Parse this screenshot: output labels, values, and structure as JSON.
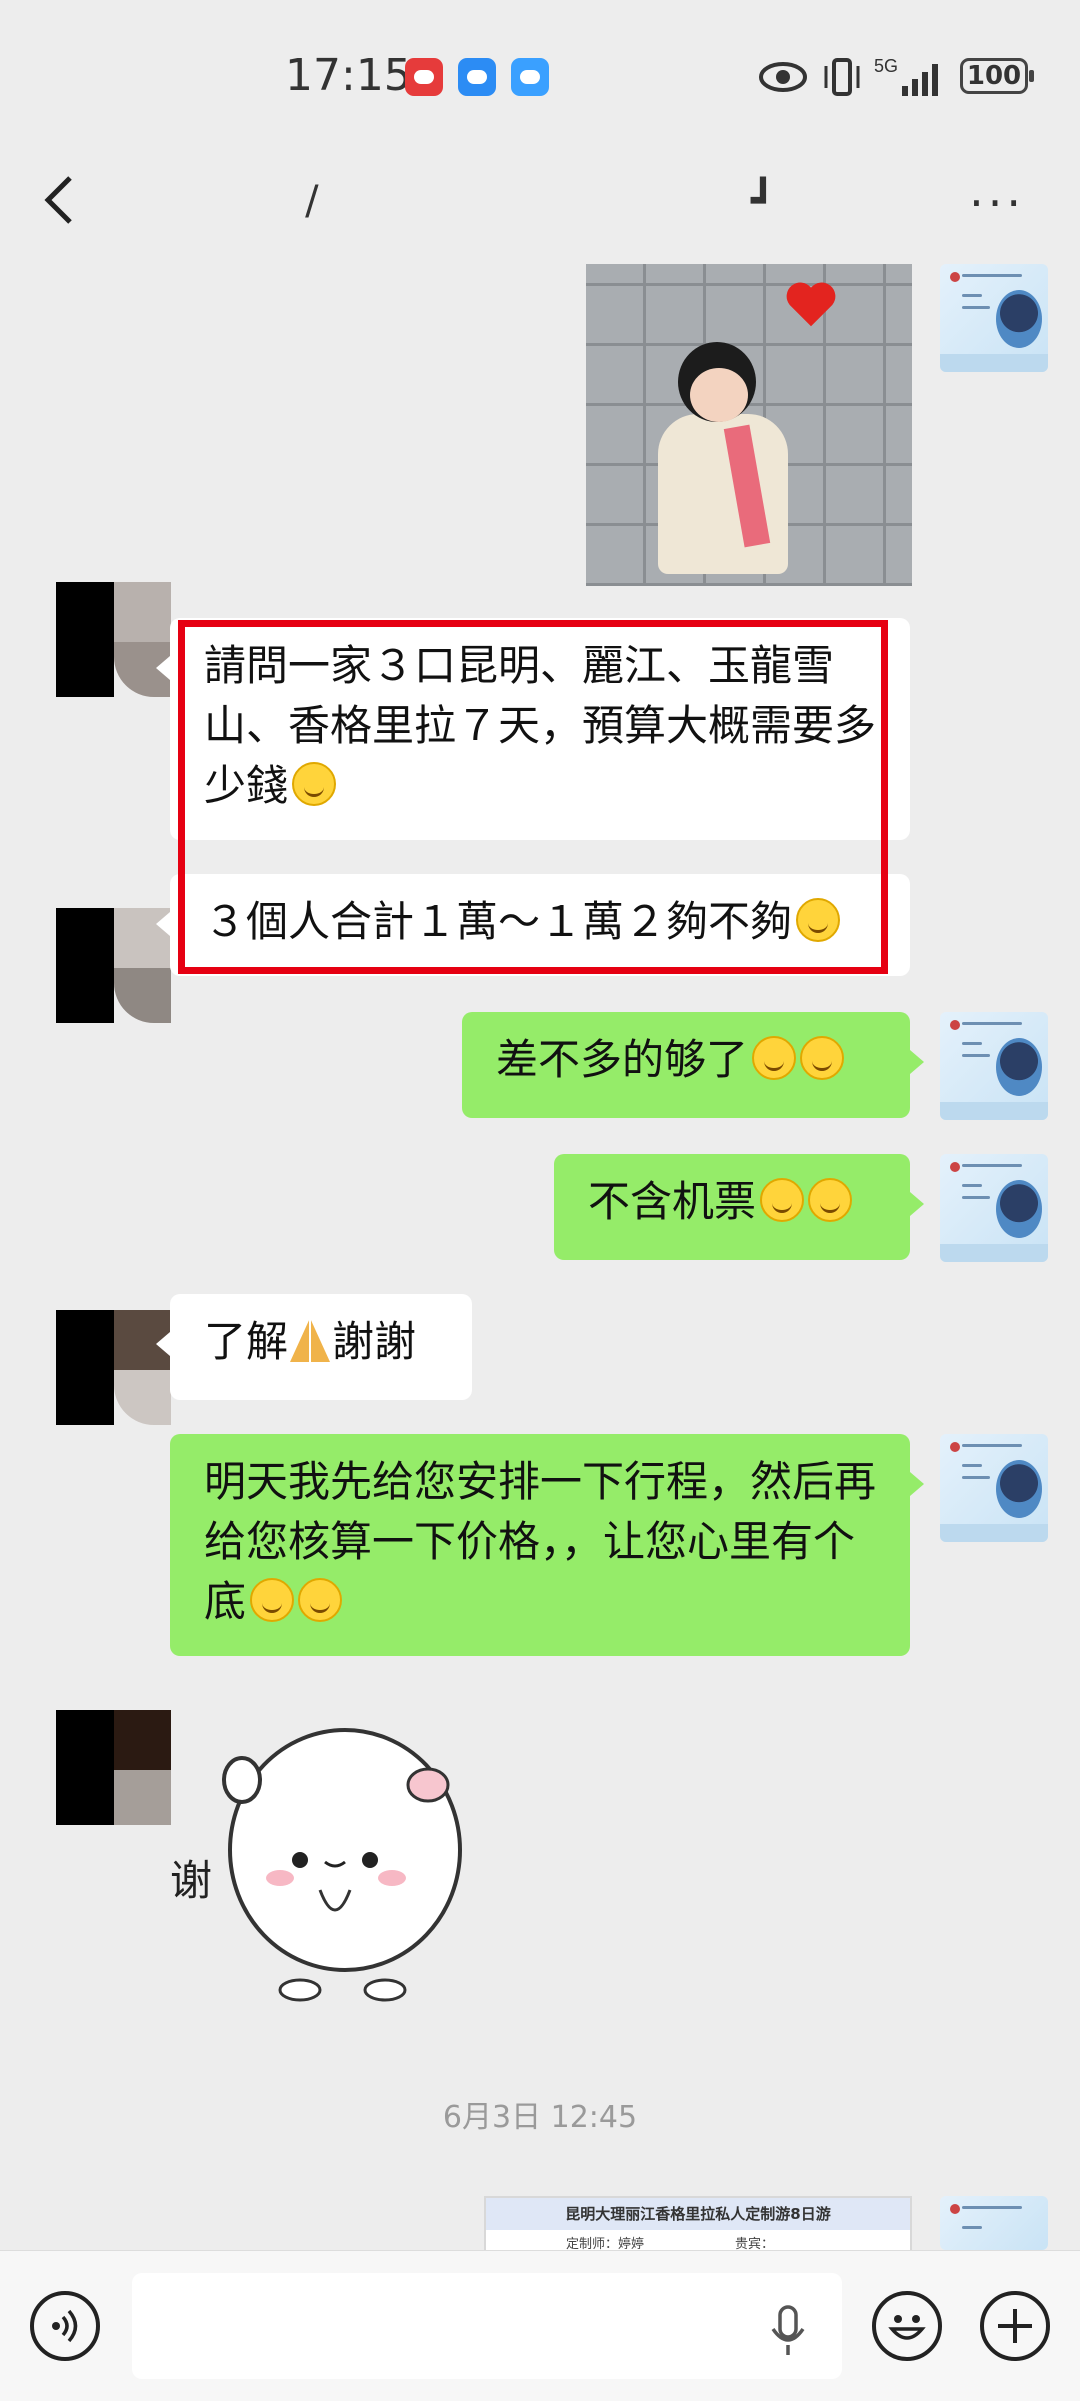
{
  "status_bar": {
    "time": "17:15",
    "network": "5G",
    "battery": "100",
    "icons": [
      "huawei-app-icon",
      "messages-icon",
      "weather-icon",
      "eye-icon",
      "vibrate-icon",
      "signal-icon",
      "battery-icon"
    ]
  },
  "nav": {
    "title": "/                                  ┛",
    "back_icon": "chevron-left-icon",
    "more_label": "···"
  },
  "messages": [
    {
      "from": "other",
      "text": "請問一家３口昆明、麗江、玉龍雪山、香格里拉７天，預算大概需要多少錢",
      "emoji": "smile"
    },
    {
      "from": "other",
      "text": "３個人合計１萬～１萬２夠不夠",
      "emoji": "laugh"
    },
    {
      "from": "me",
      "text": "差不多的够了",
      "emoji": "smile x2"
    },
    {
      "from": "me",
      "text": "不含机票",
      "emoji": "grin x2"
    },
    {
      "from": "other",
      "text_before": "了解",
      "text_after": "謝謝",
      "emoji": "pray"
    },
    {
      "from": "me",
      "text": "明天我先给您安排一下行程，然后再给您核算一下价格，，让您心里有个底",
      "emoji": "smile x2"
    }
  ],
  "sticker": {
    "label": "谢"
  },
  "timestamp": "6月3日 12:45",
  "card": {
    "title": "昆明大理丽江香格里拉私人定制游8日游",
    "line": "定制师：婷婷　　　　　　　贵宾："
  },
  "composer": {
    "placeholder": "",
    "icons": [
      "voice-icon",
      "mic-icon",
      "emoji-icon",
      "plus-icon"
    ]
  },
  "colors": {
    "background": "#ededed",
    "my_bubble": "#95ec69",
    "other_bubble": "#ffffff",
    "highlight_box": "#e60012"
  }
}
